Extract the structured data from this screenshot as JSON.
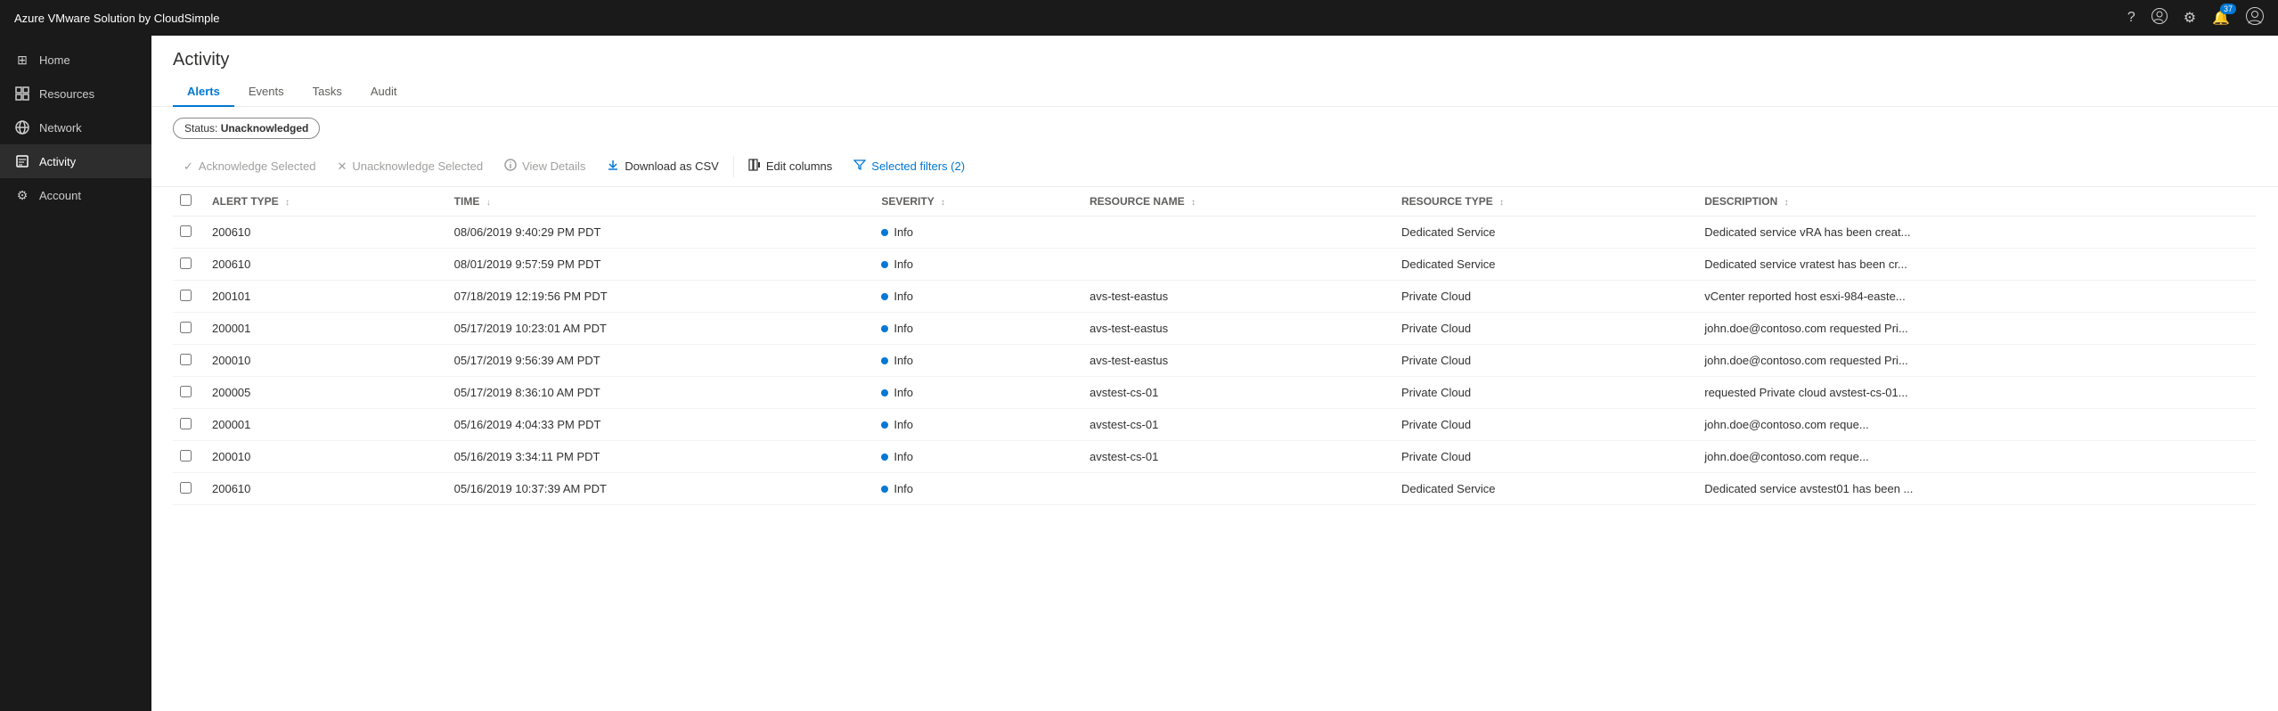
{
  "topbar": {
    "title": "Azure VMware Solution by CloudSimple",
    "notification_count": "37",
    "icons": {
      "help": "?",
      "user_circle": "👤",
      "settings": "⚙",
      "notifications": "🔔",
      "account": "👤"
    }
  },
  "sidebar": {
    "items": [
      {
        "id": "home",
        "label": "Home",
        "icon": "⊞"
      },
      {
        "id": "resources",
        "label": "Resources",
        "icon": "⊟"
      },
      {
        "id": "network",
        "label": "Network",
        "icon": "🌐"
      },
      {
        "id": "activity",
        "label": "Activity",
        "icon": "📋",
        "active": true
      },
      {
        "id": "account",
        "label": "Account",
        "icon": "⚙"
      }
    ]
  },
  "page": {
    "title": "Activity"
  },
  "tabs": [
    {
      "id": "alerts",
      "label": "Alerts",
      "active": true
    },
    {
      "id": "events",
      "label": "Events",
      "active": false
    },
    {
      "id": "tasks",
      "label": "Tasks",
      "active": false
    },
    {
      "id": "audit",
      "label": "Audit",
      "active": false
    }
  ],
  "filter": {
    "status_label": "Status:",
    "status_value": "Unacknowledged"
  },
  "toolbar": {
    "acknowledge_label": "Acknowledge Selected",
    "unacknowledge_label": "Unacknowledge Selected",
    "view_details_label": "View Details",
    "download_csv_label": "Download as CSV",
    "edit_columns_label": "Edit columns",
    "selected_filters_label": "Selected filters (2)"
  },
  "table": {
    "columns": [
      {
        "id": "alert_type",
        "label": "ALERT TYPE"
      },
      {
        "id": "time",
        "label": "TIME"
      },
      {
        "id": "severity",
        "label": "SEVERITY"
      },
      {
        "id": "resource_name",
        "label": "RESOURCE NAME"
      },
      {
        "id": "resource_type",
        "label": "RESOURCE TYPE"
      },
      {
        "id": "description",
        "label": "DESCRIPTION"
      }
    ],
    "rows": [
      {
        "alert_type": "200610",
        "time": "08/06/2019 9:40:29 PM PDT",
        "severity": "Info",
        "severity_level": "info",
        "resource_name": "",
        "resource_type": "Dedicated Service",
        "description": "Dedicated service vRA has been creat..."
      },
      {
        "alert_type": "200610",
        "time": "08/01/2019 9:57:59 PM PDT",
        "severity": "Info",
        "severity_level": "info",
        "resource_name": "",
        "resource_type": "Dedicated Service",
        "description": "Dedicated service vratest has been cr..."
      },
      {
        "alert_type": "200101",
        "time": "07/18/2019 12:19:56 PM PDT",
        "severity": "Info",
        "severity_level": "info",
        "resource_name": "avs-test-eastus",
        "resource_type": "Private Cloud",
        "description": "vCenter reported host esxi-984-easte..."
      },
      {
        "alert_type": "200001",
        "time": "05/17/2019 10:23:01 AM PDT",
        "severity": "Info",
        "severity_level": "info",
        "resource_name": "avs-test-eastus",
        "resource_type": "Private Cloud",
        "description": "john.doe@contoso.com requested Pri..."
      },
      {
        "alert_type": "200010",
        "time": "05/17/2019 9:56:39 AM PDT",
        "severity": "Info",
        "severity_level": "info",
        "resource_name": "avs-test-eastus",
        "resource_type": "Private Cloud",
        "description": "john.doe@contoso.com requested Pri..."
      },
      {
        "alert_type": "200005",
        "time": "05/17/2019 8:36:10 AM PDT",
        "severity": "Info",
        "severity_level": "info",
        "resource_name": "avstest-cs-01",
        "resource_type": "Private Cloud",
        "description": "requested Private cloud avstest-cs-01..."
      },
      {
        "alert_type": "200001",
        "time": "05/16/2019 4:04:33 PM PDT",
        "severity": "Info",
        "severity_level": "info",
        "resource_name": "avstest-cs-01",
        "resource_type": "Private Cloud",
        "description": "john.doe@contoso.com   reque..."
      },
      {
        "alert_type": "200010",
        "time": "05/16/2019 3:34:11 PM PDT",
        "severity": "Info",
        "severity_level": "info",
        "resource_name": "avstest-cs-01",
        "resource_type": "Private Cloud",
        "description": "john.doe@contoso.com   reque..."
      },
      {
        "alert_type": "200610",
        "time": "05/16/2019 10:37:39 AM PDT",
        "severity": "Info",
        "severity_level": "info",
        "resource_name": "",
        "resource_type": "Dedicated Service",
        "description": "Dedicated service avstest01 has been ..."
      }
    ]
  }
}
